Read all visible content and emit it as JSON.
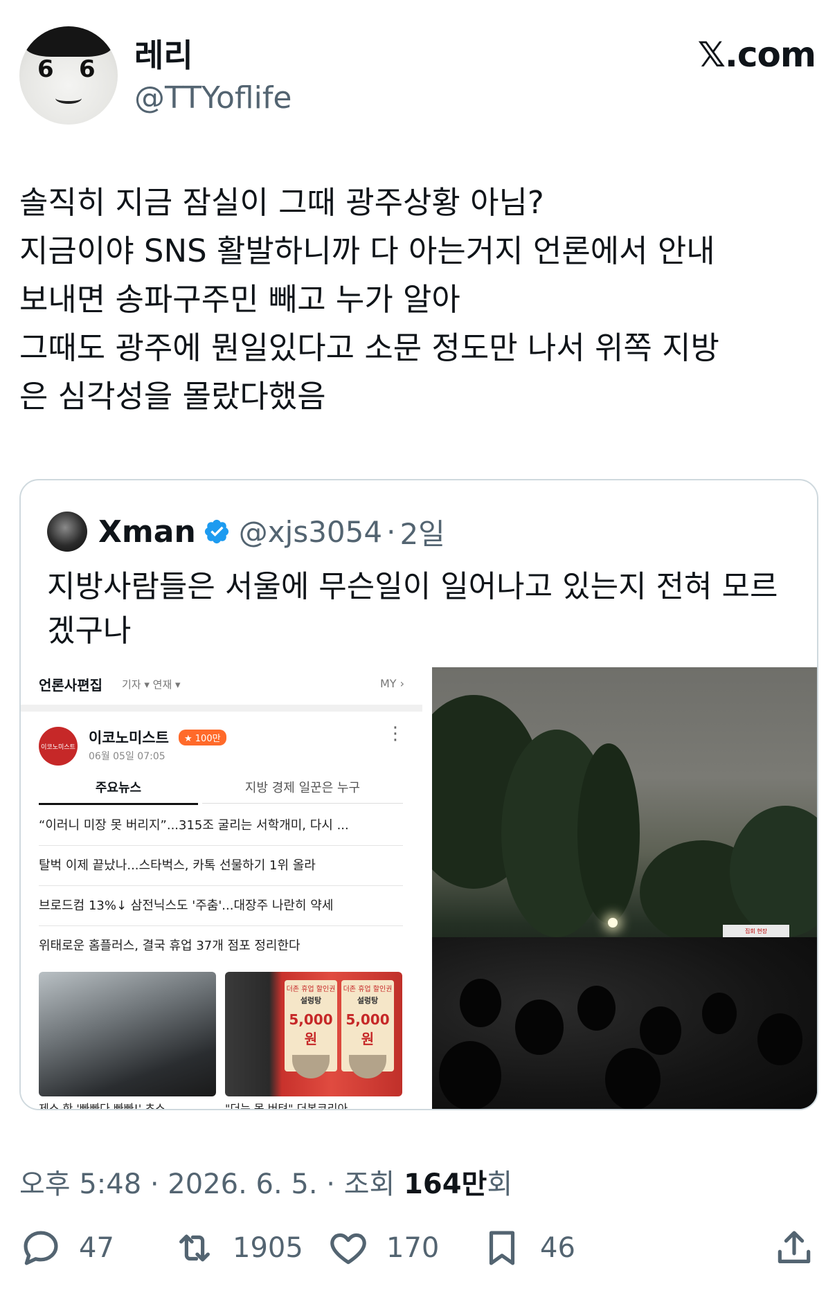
{
  "author": {
    "name": "레리",
    "handle": "@TTYoflife"
  },
  "brand": "𝕏.com",
  "tweet": {
    "lines": [
      "솔직히 지금 잠실이 그때 광주상황 아님?",
      "지금이야 SNS 활발하니까 다 아는거지 언론에서 안내",
      "보내면 송파구주민 빼고 누가 알아",
      "그때도 광주에 뭔일있다고 소문 정도만 나서 위쪽 지방",
      "은 심각성을 몰랐다했음"
    ]
  },
  "quote": {
    "name": "Xman",
    "handle": "@xjs3054",
    "separator": "·",
    "time": "2일",
    "text": "지방사람들은 서울에 무슨일이 일어나고 있는지 전혀 모르겠구나",
    "screenshot": {
      "title": "언론사편집",
      "sub": "기자 ▾  연재 ▾",
      "my": "MY ›",
      "publisher": "이코노미스트",
      "publisher_logo_text": "이코노미스트",
      "badge": "★ 100만",
      "date": "06월 05일 07:05",
      "tab_main": "주요뉴스",
      "tab_other": "지방 경제 일꾼은 누구",
      "headlines": [
        "“이러니 미장 못 버리지”...315조 굴리는 서학개미, 다시 ...",
        "탈벅 이제 끝났나...스타벅스, 카톡 선물하기 1위 올라",
        "브로드컴 13%↓ 삼전닉스도 '주춤'...대장주 나란히 약세",
        "위태로운 홈플러스, 결국 휴업 37개 점포 정리한다"
      ],
      "menu_top": "더존 휴업 할인권",
      "menu_name": "설렁탕",
      "menu_price": "5,000원",
      "caption_left": "제스 한 '빠빠다 빠빠!' 초스",
      "caption_right": "\"더는 못 버텨\" 더본코리아"
    },
    "photo_banner": "집회 현장"
  },
  "meta": {
    "time": "오후 5:48",
    "sep1": "·",
    "date": "2026. 6. 5.",
    "sep2": "·",
    "views_label": "조회",
    "views_value": "164만",
    "views_suffix": "회"
  },
  "actions": {
    "reply_icon": "reply-icon",
    "reply_count": "47",
    "retweet_icon": "retweet-icon",
    "retweet_count": "1905",
    "like_icon": "heart-icon",
    "like_count": "170",
    "bookmark_icon": "bookmark-icon",
    "bookmark_count": "46",
    "share_icon": "share-icon"
  },
  "colors": {
    "text": "#0f1419",
    "secondary": "#536471",
    "border": "#cfd9de",
    "verified": "#1d9bf0"
  }
}
